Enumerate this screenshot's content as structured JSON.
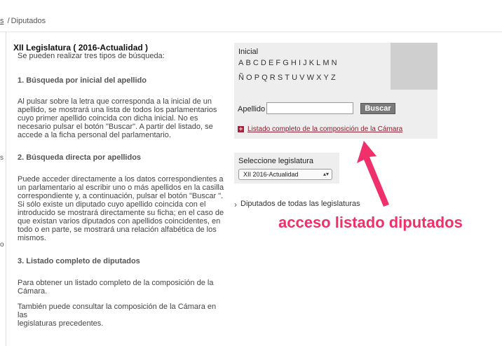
{
  "breadcrumb": {
    "link_fragment": "s",
    "separator": "/",
    "current": "Diputados"
  },
  "left_fragments": [
    "s",
    "o"
  ],
  "legislature": {
    "title": "XII Legislatura ( 2016-Actualidad )",
    "intro": "Se pueden realizar tres tipos de búsqueda:"
  },
  "sections": [
    {
      "heading": "1. Búsqueda por inicial del apellido",
      "lines": [
        "Al pulsar sobre la letra que corresponda a la inicial de un",
        "apellido, se mostrará una lista de todos los parlamentarios",
        "cuyo primer apellido coincida con dicha inicial. No es",
        "necesario pulsar el botón \"Buscar\". A partir del listado, se",
        "accede a la ficha personal del parlamentario."
      ]
    },
    {
      "heading": "2. Búsqueda directa por apellidos",
      "lines": [
        "Puede acceder directamente a los datos correspondientes a",
        "un parlamentario al escribir uno o más apellidos en la casilla",
        "correspondiente y, a continuación, pulsar el botón \"Buscar \".",
        "Si sólo existe un diputado cuyo apellido coincida con el",
        "introducido se mostrará directamente su ficha; en el caso de",
        "que existan varios diputados con apellidos coincidentes, en",
        "todo o en parte, se mostrará una relación alfabética de los",
        "mismos."
      ]
    },
    {
      "heading": "3. Listado completo de diputados",
      "lines": [
        "Para obtener un listado completo de la composición de la",
        "Cámara."
      ],
      "lines2": [
        "También puede consultar la composición de la Cámara en las",
        "legislaturas precedentes."
      ]
    }
  ],
  "search": {
    "inicial_label": "Inicial",
    "letters_row1": [
      "A",
      "B",
      "C",
      "D",
      "E",
      "F",
      "G",
      "H",
      "I",
      "J",
      "K",
      "L",
      "M",
      "N"
    ],
    "letters_row2": [
      "Ñ",
      "O",
      "P",
      "Q",
      "R",
      "S",
      "T",
      "U",
      "V",
      "W",
      "X",
      "Y",
      "Z"
    ],
    "apellido_label": "Apellido",
    "apellido_value": "",
    "buscar_label": "Buscar",
    "listado_link": "Listado completo de la composición de la Cámara"
  },
  "legislatura_select": {
    "label": "Seleccione legislatura",
    "selected": "XII  2016-Actualidad"
  },
  "todas_link": "Diputados de todas las legislaturas",
  "annotation": {
    "text": "acceso listado diputados",
    "color": "#f0306a"
  },
  "colors": {
    "link_red": "#8b1e30",
    "panel_bg": "#eeeeee",
    "button_bg": "#7a7a7a"
  }
}
